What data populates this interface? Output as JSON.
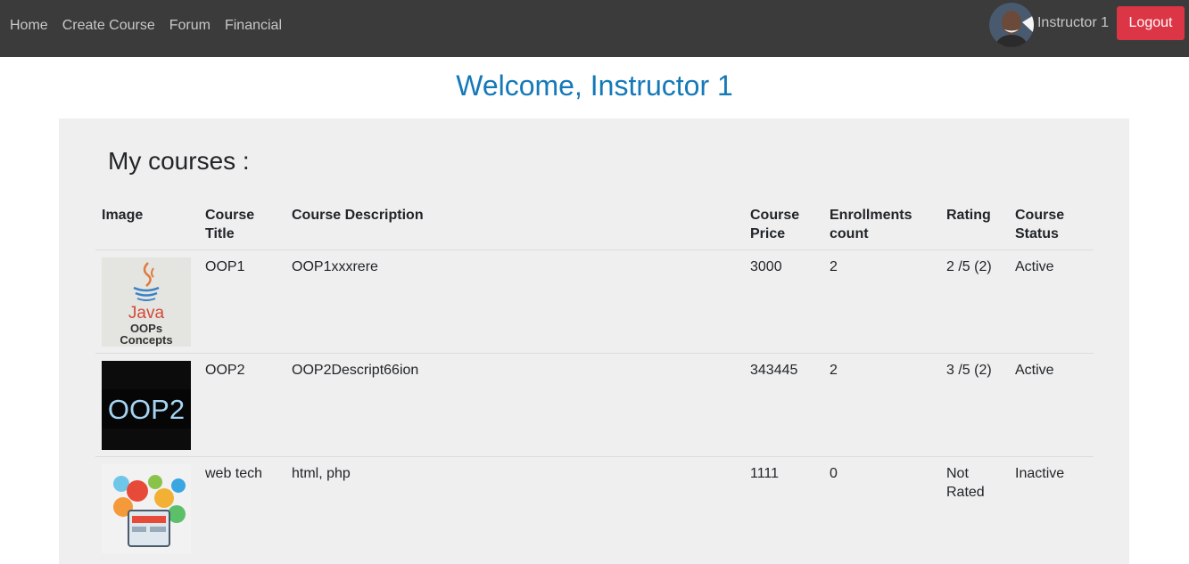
{
  "nav": {
    "links": [
      "Home",
      "Create Course",
      "Forum",
      "Financial"
    ],
    "user_name": "Instructor 1",
    "logout_label": "Logout"
  },
  "welcome": "Welcome, Instructor 1",
  "section_title": "My courses :",
  "table": {
    "headers": [
      "Image",
      "Course Title",
      "Course Description",
      "Course Price",
      "Enrollments count",
      "Rating",
      "Course Status"
    ],
    "rows": [
      {
        "image": "java-oops-thumbnail",
        "title": "OOP1",
        "description": "OOP1xxxrere",
        "price": "3000",
        "enrollments": "2",
        "rating": "2 /5 (2)",
        "status": "Active"
      },
      {
        "image": "oop2-thumbnail",
        "title": "OOP2",
        "description": "OOP2Descript66ion",
        "price": "343445",
        "enrollments": "2",
        "rating": "3 /5 (2)",
        "status": "Active"
      },
      {
        "image": "web-tech-thumbnail",
        "title": "web tech",
        "description": "html, php",
        "price": "1111",
        "enrollments": "0",
        "rating": "Not Rated",
        "status": "Inactive"
      }
    ]
  },
  "thumb_text": {
    "java": "Java",
    "oops": "OOPs",
    "concepts": "Concepts",
    "oop2": "OOP2"
  },
  "colors": {
    "navbar": "#3b3b3b",
    "welcome": "#1579b8",
    "logout": "#dc3545",
    "panel": "#efefef"
  }
}
